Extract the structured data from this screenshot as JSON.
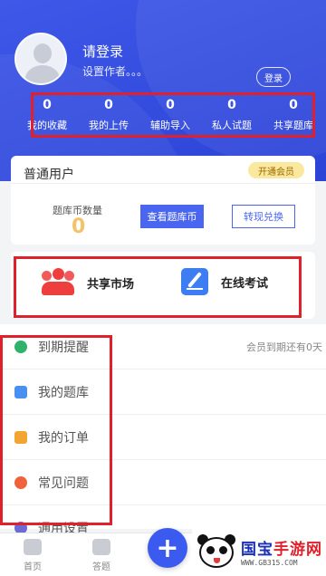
{
  "profile": {
    "title": "请登录",
    "subtitle": "设置作者。。。",
    "login_button": "登录"
  },
  "stats": [
    {
      "value": "0",
      "label": "我的收藏"
    },
    {
      "value": "0",
      "label": "我的上传"
    },
    {
      "value": "0",
      "label": "辅助导入"
    },
    {
      "value": "0",
      "label": "私人试题"
    },
    {
      "value": "0",
      "label": "共享题库"
    }
  ],
  "account": {
    "user_type": "普通用户",
    "vip_button": "开通会员",
    "coin_label": "题库币数量",
    "coin_value": "0",
    "view_coin_button": "查看题库币",
    "withdraw_button": "转现兑换"
  },
  "quick_actions": [
    {
      "label": "共享市场",
      "icon": "team-icon"
    },
    {
      "label": "在线考试",
      "icon": "edit-icon"
    }
  ],
  "menu": [
    {
      "label": "到期提醒",
      "extra": "会员到期还有0天",
      "icon_color": "#2fb36b"
    },
    {
      "label": "我的题库",
      "extra": "",
      "icon_color": "#4a90f0"
    },
    {
      "label": "我的订单",
      "extra": "",
      "icon_color": "#f2a62f"
    },
    {
      "label": "常见问题",
      "extra": "",
      "icon_color": "#f0623a"
    },
    {
      "label": "通用设置",
      "extra": "",
      "icon_color": "#6b6bd6"
    }
  ],
  "tabbar": {
    "home": "首页",
    "answer": "答题",
    "fab": "+"
  },
  "watermark": {
    "brand_part1": "国宝",
    "brand_part2": "手游网",
    "url": "WWW.GB315.COM"
  },
  "colors": {
    "primary": "#3b5bf0",
    "annotation": "#e0202a",
    "vip": "#fbe89f",
    "coin": "#f2c36b"
  }
}
